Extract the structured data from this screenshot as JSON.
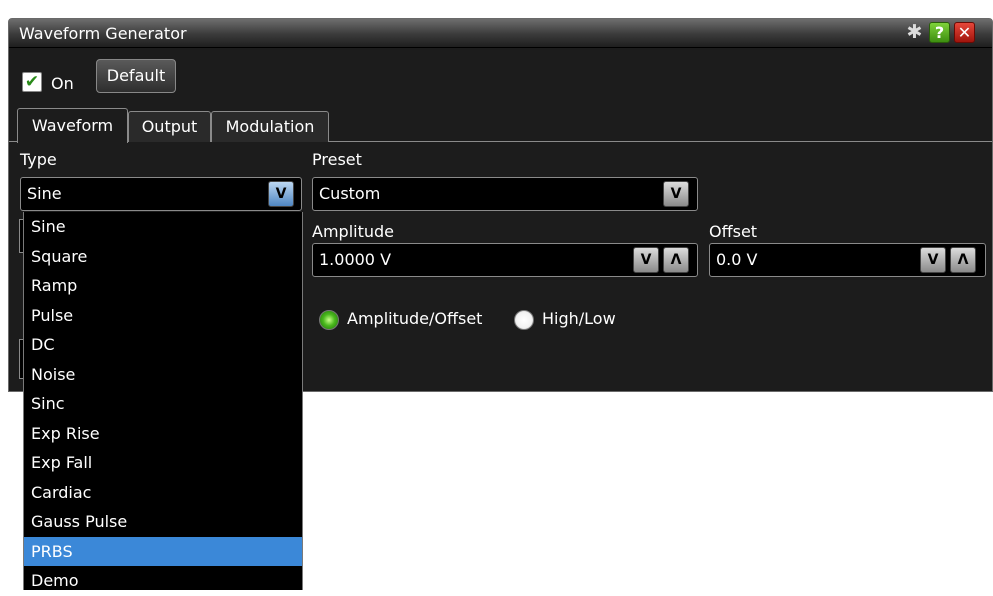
{
  "window": {
    "title": "Waveform Generator",
    "titlebar_buttons": [
      {
        "name": "settings",
        "icon": "gear-icon",
        "glyph": "✱"
      },
      {
        "name": "help",
        "icon": "help-icon",
        "glyph": "?"
      },
      {
        "name": "close",
        "icon": "close-icon",
        "glyph": "✕"
      }
    ]
  },
  "toolbar": {
    "on_checked": true,
    "check_glyph": "✔",
    "on_label": "On",
    "default_label": "Default"
  },
  "tabs": [
    {
      "label": "Waveform",
      "active": true
    },
    {
      "label": "Output",
      "active": false
    },
    {
      "label": "Modulation",
      "active": false
    }
  ],
  "type": {
    "label": "Type",
    "value": "Sine",
    "options": [
      "Sine",
      "Square",
      "Ramp",
      "Pulse",
      "DC",
      "Noise",
      "Sinc",
      "Exp Rise",
      "Exp Fall",
      "Cardiac",
      "Gauss Pulse",
      "PRBS",
      "Demo"
    ],
    "highlighted": "PRBS"
  },
  "preset": {
    "label": "Preset",
    "value": "Custom"
  },
  "amplitude": {
    "label": "Amplitude",
    "value": "1.0000 V"
  },
  "offset": {
    "label": "Offset",
    "value": "0.0 V"
  },
  "mode": {
    "options": [
      "Amplitude/Offset",
      "High/Low"
    ],
    "selected": "Amplitude/Offset"
  },
  "glyphs": {
    "down": "V",
    "up": "Λ"
  },
  "colors": {
    "accent_selected": "#3b88d8",
    "help_green": "#4aa81a",
    "close_red": "#c8281c",
    "radio_on": "#3fb01a"
  }
}
